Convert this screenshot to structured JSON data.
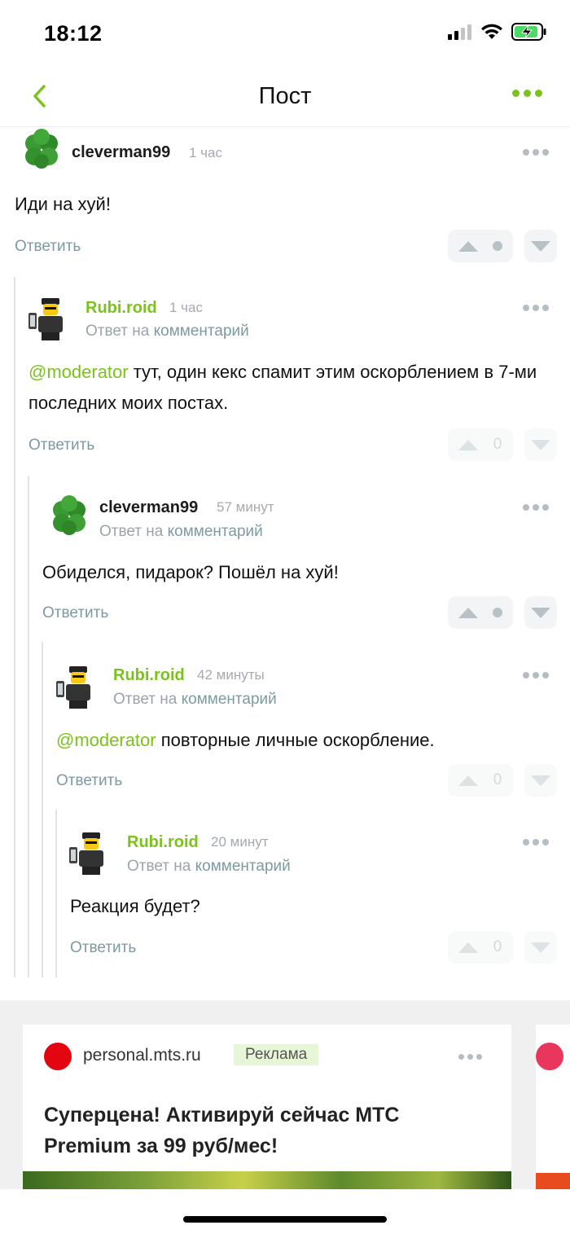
{
  "status_bar": {
    "time": "18:12"
  },
  "nav": {
    "title": "Пост"
  },
  "comments": [
    {
      "author": "cleverman99",
      "time": "1 час",
      "reply_to": null,
      "mention": "",
      "text": "Иди на хуй!",
      "reply_label": "Ответить",
      "score": ""
    },
    {
      "author": "Rubi.roid",
      "time": "1 час",
      "reply_to_prefix": "Ответ на",
      "reply_to_link": "комментарий",
      "mention": "@moderator",
      "text": " тут, один кекс спамит этим оскорблением в 7-ми последних моих постах.",
      "reply_label": "Ответить",
      "score": "0"
    },
    {
      "author": "cleverman99",
      "time": "57 минут",
      "reply_to_prefix": "Ответ на",
      "reply_to_link": "комментарий",
      "mention": "",
      "text": "Обиделся, пидарок? Пошёл на хуй!",
      "reply_label": "Ответить",
      "score": ""
    },
    {
      "author": "Rubi.roid",
      "time": "42 минуты",
      "reply_to_prefix": "Ответ на",
      "reply_to_link": "комментарий",
      "mention": "@moderator",
      "text": " повторные личные оскорбление.",
      "reply_label": "Ответить",
      "score": "0"
    },
    {
      "author": "Rubi.roid",
      "time": "20 минут",
      "reply_to_prefix": "Ответ на",
      "reply_to_link": "комментарий",
      "mention": "",
      "text": "Реакция будет?",
      "reply_label": "Ответить",
      "score": "0"
    }
  ],
  "ad": {
    "domain": "personal.mts.ru",
    "badge": "Реклама",
    "title": "Суперцена! Активируй сейчас МТС Premium за 99 руб/мес!"
  },
  "colors": {
    "accent": "#7bc31a",
    "brand_ad": "#e30611"
  }
}
